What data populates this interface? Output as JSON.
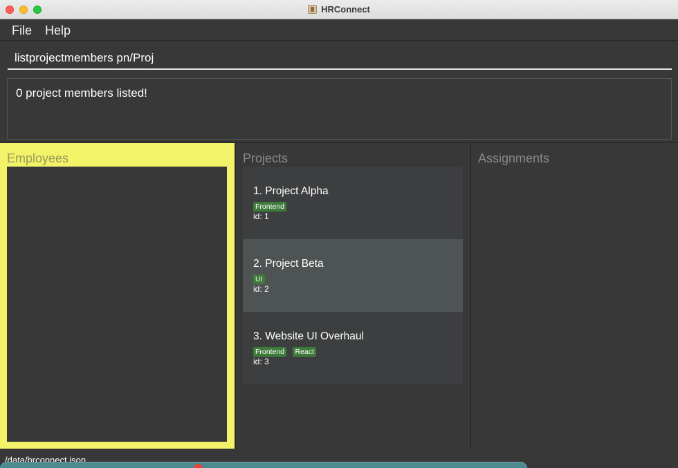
{
  "window": {
    "title": "HRConnect"
  },
  "menu": {
    "file": "File",
    "help": "Help"
  },
  "command": {
    "value": "listprojectmembers pn/Proj"
  },
  "result": {
    "message": "0 project members listed!"
  },
  "panels": {
    "employees": {
      "title": "Employees"
    },
    "projects": {
      "title": "Projects",
      "items": [
        {
          "name": "1. Project Alpha",
          "tags": [
            "Frontend"
          ],
          "id": "id: 1"
        },
        {
          "name": "2. Project Beta",
          "tags": [
            "UI"
          ],
          "id": "id: 2"
        },
        {
          "name": "3. Website UI Overhaul",
          "tags": [
            "Frontend",
            "React"
          ],
          "id": "id: 3"
        }
      ]
    },
    "assignments": {
      "title": "Assignments"
    }
  },
  "status": {
    "path": "/data/hrconnect.json"
  },
  "colors": {
    "accent_yellow": "#f3f36a",
    "tag_green": "#3e7b3a",
    "background": "#383838"
  }
}
